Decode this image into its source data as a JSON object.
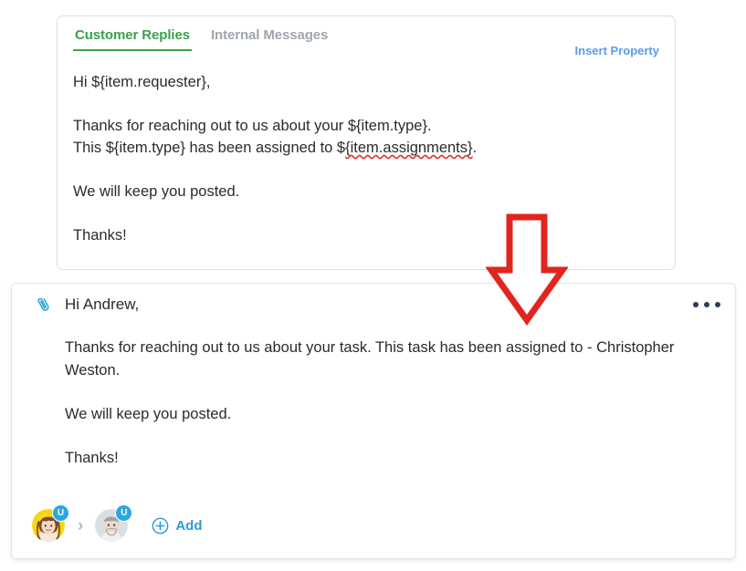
{
  "editor": {
    "tabs": [
      {
        "label": "Customer Replies",
        "active": true
      },
      {
        "label": "Internal Messages",
        "active": false
      }
    ],
    "insert_property_label": "Insert Property",
    "template_lines": {
      "greeting": "Hi ${item.requester},",
      "paragraph_line1": "Thanks for reaching out to us about your ${item.type}.",
      "paragraph_line2_prefix": "This ${item.type} has been assigned to $",
      "paragraph_line2_misspelled": "{item.assignments}",
      "paragraph_line2_suffix": ".",
      "closing": "We will keep you posted.",
      "signoff": "Thanks!"
    },
    "active_tab_color": "#38a24a",
    "inactive_tab_color": "#9fa6ad",
    "link_color": "#5b9bef",
    "spellcheck_color": "#e8302a"
  },
  "message": {
    "attachment_icon": "paperclip-icon",
    "overflow_icon": "ellipsis-icon",
    "greeting": "Hi Andrew,",
    "paragraph1": "Thanks for reaching out to us about your task. This task has been assigned to  - Christopher Weston.",
    "paragraph2": "We will keep you posted.",
    "paragraph3": "Thanks!",
    "assignees": [
      {
        "name": "avatar-requester",
        "badge": "U",
        "background": "#f5d613"
      },
      {
        "name": "avatar-assignee",
        "badge": "U",
        "background": "#d9dbdd"
      }
    ],
    "chevron": "›",
    "add_label": "Add",
    "add_icon": "plus-circle-icon",
    "badge_color": "#29a8e0",
    "add_color": "#2e9bd6",
    "attachment_color": "#2aa8d8",
    "overflow_color": "#2f3c56"
  },
  "annotation": {
    "arrow": "down-arrow-annotation",
    "color": "#e2241f",
    "direction": "down"
  }
}
